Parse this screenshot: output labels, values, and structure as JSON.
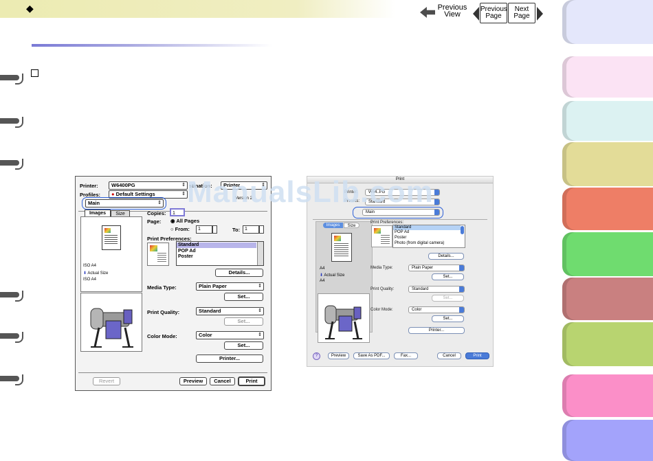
{
  "header": {
    "bullet_glyph": "◆"
  },
  "nav": {
    "previous_view": [
      "Previous",
      "View"
    ],
    "previous_page": [
      "Previous",
      "Page"
    ],
    "next_page": [
      "Next",
      "Page"
    ]
  },
  "side_tabs": {
    "colors": [
      "#e4e7fb",
      "#fbe3f4",
      "#dcf2f2",
      "#e3dc98",
      "#ee7e66",
      "#6fdc6f",
      "#c98080",
      "#b8d470",
      "#fb8fc8",
      "#a3a3fb"
    ]
  },
  "watermark": "ManualsLib.com",
  "dialog_classic": {
    "printer_label": "Printer:",
    "printer_value": "W6400PG",
    "destination_label": "stination:",
    "destination_value": "Printer",
    "profiles_label": "Profiles:",
    "profiles_value": "Default Settings",
    "panel_value": "Main",
    "version": "Version 2",
    "tabs": [
      "Images",
      "Size"
    ],
    "copies_label": "Copies:",
    "copies_value": "1",
    "page_label": "Page:",
    "all_pages": "All Pages",
    "from_label": "From:",
    "from_value": "1",
    "to_label": "To:",
    "to_value": "1",
    "print_prefs_label": "Print Preferences:",
    "prefs_items": [
      "Standard",
      "POP Ad",
      "Poster"
    ],
    "paper_info": [
      "ISO A4",
      "Actual Size",
      "ISO A4"
    ],
    "details_button": "Details...",
    "media_type_label": "Media Type:",
    "media_type_value": "Plain Paper",
    "set_button": "Set...",
    "print_quality_label": "Print Quality:",
    "print_quality_value": "Standard",
    "color_mode_label": "Color Mode:",
    "color_mode_value": "Color",
    "printer_button": "Printer...",
    "revert_button": "Revert",
    "preview_button": "Preview",
    "cancel_button": "Cancel",
    "print_button": "Print"
  },
  "dialog_aqua": {
    "title": "Print",
    "printer_label": "Printer:",
    "printer_value": "W64..PG",
    "presets_label": "Presets:",
    "presets_value": "Standard",
    "panel_value": "Main",
    "tabs": [
      "Images",
      "Size"
    ],
    "print_prefs_label": "Print Preferences:",
    "prefs_items": [
      "Standard",
      "POP Ad",
      "Poster",
      "Photo (from digital camera)"
    ],
    "paper_info": [
      "A4",
      "Actual Size",
      "A4"
    ],
    "details_button": "Details...",
    "media_type_label": "Media Type:",
    "media_type_value": "Plain Paper",
    "set_button": "Set...",
    "print_quality_label": "Print Quality:",
    "print_quality_value": "Standard",
    "color_mode_label": "Color Mode:",
    "color_mode_value": "Color",
    "printer_button": "Printer...",
    "help_glyph": "?",
    "preview_button": "Preview",
    "save_pdf_button": "Save As PDF...",
    "fax_button": "Fax...",
    "cancel_button": "Cancel",
    "print_button": "Print"
  }
}
